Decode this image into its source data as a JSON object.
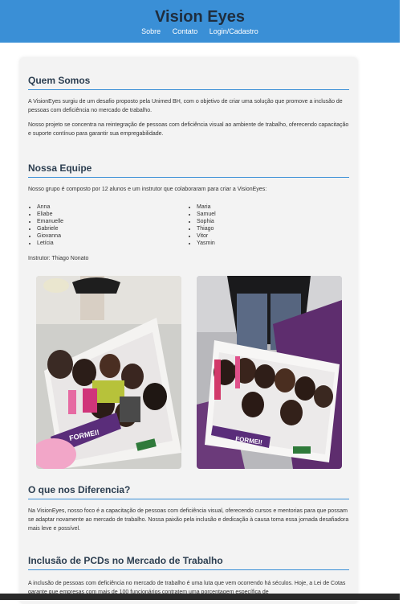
{
  "header": {
    "title": "Vision Eyes",
    "nav": [
      "Sobre",
      "Contato",
      "Login/Cadastro"
    ]
  },
  "sections": {
    "about": {
      "title": "Quem Somos",
      "p1": "A VisionEyes surgiu de um desafio proposto pela Unimed BH, com o objetivo de criar uma solução que promove a inclusão de pessoas com deficiência no mercado de trabalho.",
      "p2": "Nosso projeto se concentra na reintegração de pessoas com deficiência visual ao ambiente de trabalho, oferecendo capacitação e suporte contínuo para garantir sua empregabilidade."
    },
    "team": {
      "title": "Nossa Equipe",
      "intro": "Nosso grupo é composto por 12 alunos e um instrutor que colaboraram para criar a VisionEyes:",
      "col1": [
        "Anna",
        "Eliabe",
        "Emanuelle",
        "Gabriele",
        "Giovanna",
        "Letícia"
      ],
      "col2": [
        "Maria",
        "Samuel",
        "Sophia",
        "Thiago",
        "Vitor",
        "Yasmin"
      ],
      "instructor": "Instrutor: Thiago Nonato",
      "photo_sign": "FORMEI!"
    },
    "diff": {
      "title": "O que nos Diferencia?",
      "p1": "Na VisionEyes, nosso foco é a capacitação de pessoas com deficiência visual, oferecendo cursos e mentorias para que possam se adaptar novamente ao mercado de trabalho. Nossa paixão pela inclusão e dedicação à causa torna essa jornada desafiadora mais leve e possível."
    },
    "pcd": {
      "title": "Inclusão de PCDs no Mercado de Trabalho",
      "p1": "A inclusão de pessoas com deficiência no mercado de trabalho é uma luta que vem ocorrendo há séculos. Hoje, a Lei de Cotas garante que empresas com mais de 100 funcionários contratem uma porcentagem específica de"
    }
  },
  "colors": {
    "header_bg": "#3a8fd6",
    "accent": "#3a8fd6",
    "title": "#2c3e50"
  }
}
